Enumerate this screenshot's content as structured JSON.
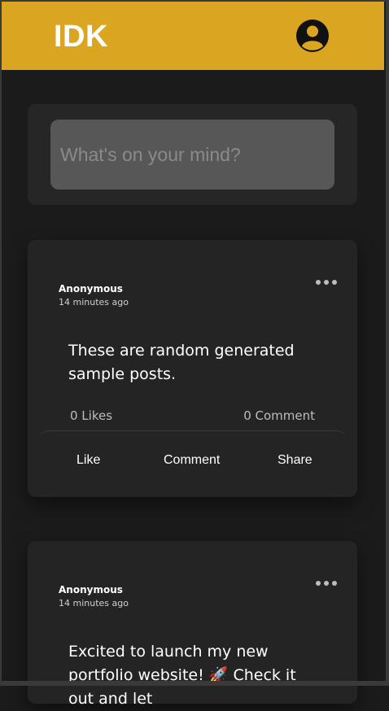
{
  "header": {
    "logo": "IDK",
    "brand_color": "#daa520",
    "profile_icon": "user-avatar-icon"
  },
  "composer": {
    "placeholder": "What's on your mind?"
  },
  "posts": [
    {
      "author": "Anonymous",
      "time": "14 minutes ago",
      "content": "These are random generated sample posts.",
      "likes": "0 Likes",
      "comments": "0 Comment",
      "actions": {
        "like": "Like",
        "comment": "Comment",
        "share": "Share"
      },
      "menu_icon": "more-horizontal-icon"
    },
    {
      "author": "Anonymous",
      "time": "14 minutes ago",
      "content": "Excited to launch my new portfolio website! 🚀 Check it out and let",
      "menu_icon": "more-horizontal-icon"
    }
  ]
}
